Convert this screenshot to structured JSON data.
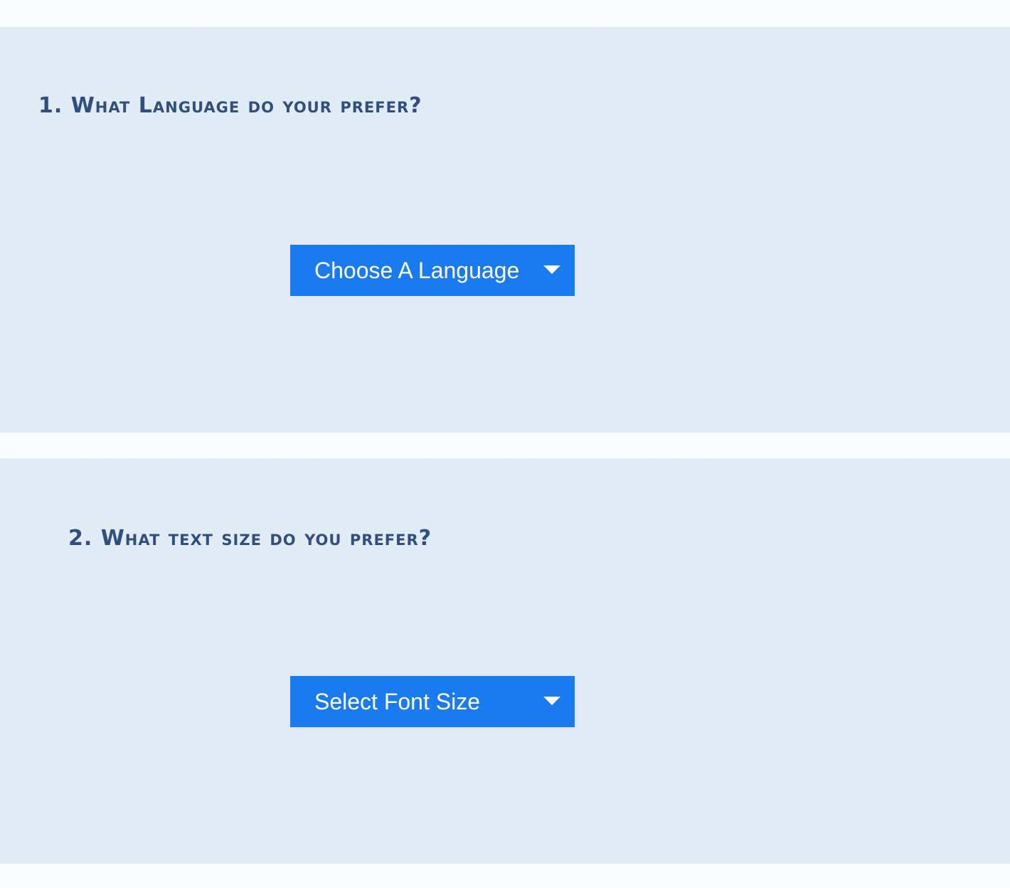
{
  "sections": [
    {
      "question": "1. What Language do your prefer?",
      "dropdown": {
        "selected_label": "Choose A Language",
        "icon": "caret-down-icon"
      }
    },
    {
      "question": "2. What text size do you prefer?",
      "dropdown": {
        "selected_label": "Select Font Size",
        "icon": "caret-down-icon"
      }
    }
  ],
  "colors": {
    "page_background": "#fbfcfd",
    "panel_background": "#dfeaf5",
    "heading_text": "#304f7e",
    "dropdown_background": "#1a7af0",
    "dropdown_text": "#ffffff"
  }
}
